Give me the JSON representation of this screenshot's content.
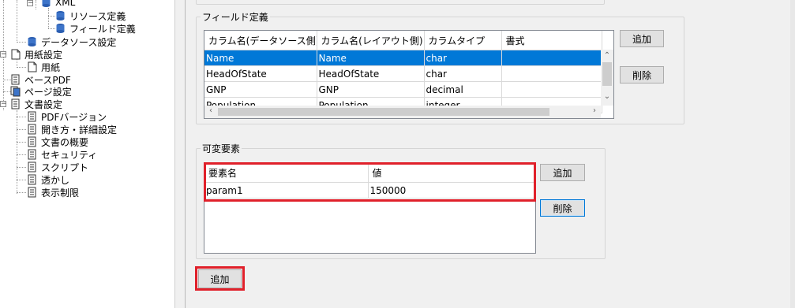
{
  "tree": {
    "items": [
      {
        "label": "XML",
        "icon": "database-icon"
      },
      {
        "label": "リソース定義",
        "icon": "database-icon"
      },
      {
        "label": "フィールド定義",
        "icon": "database-icon"
      },
      {
        "label": "データソース設定",
        "icon": "database-icon"
      },
      {
        "label": "用紙設定",
        "icon": "page-icon"
      },
      {
        "label": "用紙",
        "icon": "page-icon"
      },
      {
        "label": "ベースPDF",
        "icon": "document-icon"
      },
      {
        "label": "ページ設定",
        "icon": "pages-icon"
      },
      {
        "label": "文書設定",
        "icon": "document-icon"
      },
      {
        "label": "PDFバージョン",
        "icon": "document-icon"
      },
      {
        "label": "開き方・詳細設定",
        "icon": "document-icon"
      },
      {
        "label": "文書の概要",
        "icon": "document-icon"
      },
      {
        "label": "セキュリティ",
        "icon": "document-icon"
      },
      {
        "label": "スクリプト",
        "icon": "document-icon"
      },
      {
        "label": "透かし",
        "icon": "document-icon"
      },
      {
        "label": "表示制限",
        "icon": "document-icon"
      }
    ]
  },
  "field_def": {
    "title": "フィールド定義",
    "columns": [
      "カラム名(データソース側)",
      "カラム名(レイアウト側)",
      "カラムタイプ",
      "書式"
    ],
    "rows": [
      [
        "Name",
        "Name",
        "char",
        ""
      ],
      [
        "HeadOfState",
        "HeadOfState",
        "char",
        ""
      ],
      [
        "GNP",
        "GNP",
        "decimal",
        ""
      ],
      [
        "Population",
        "Population",
        "integer",
        ""
      ]
    ],
    "add_label": "追加",
    "delete_label": "削除"
  },
  "variable": {
    "title": "可変要素",
    "columns": [
      "要素名",
      "値"
    ],
    "rows": [
      [
        "param1",
        "150000"
      ]
    ],
    "add_label": "追加",
    "delete_label": "削除"
  },
  "bottom": {
    "add_label": "追加"
  },
  "colors": {
    "selection": "#0078d7",
    "highlight": "#e0202a"
  }
}
